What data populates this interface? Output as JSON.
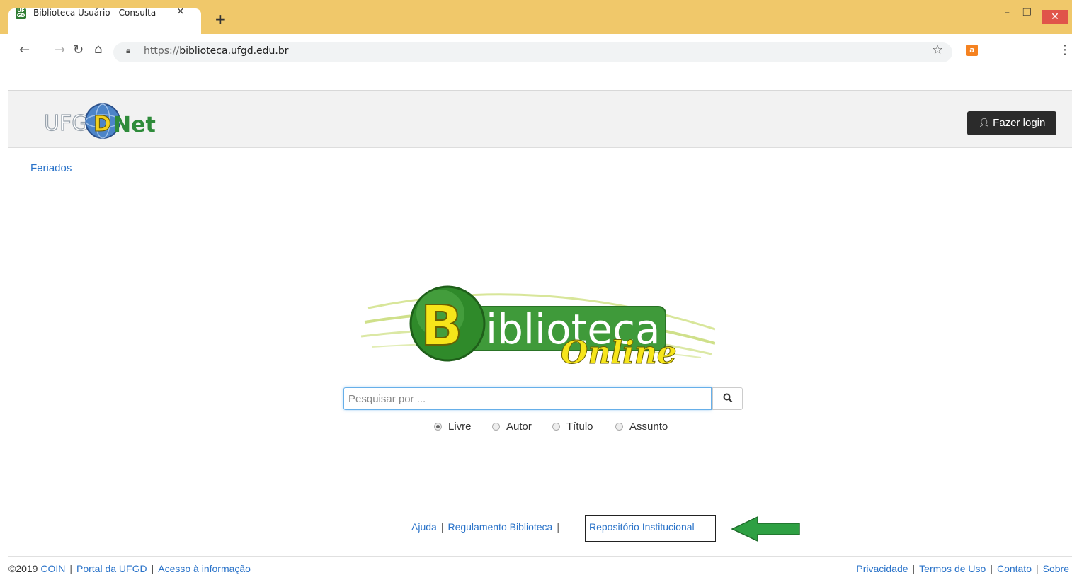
{
  "browser": {
    "tab_title": "Biblioteca Usuário - Consulta",
    "favicon_text": "UF GD",
    "close_tab": "×",
    "new_tab": "+",
    "url_scheme": "https://",
    "url_host": "biblioteca.ufgd.edu.br",
    "extension_label": "a",
    "icons": [
      "back-icon",
      "forward-icon",
      "reload-icon",
      "home-icon",
      "lock-icon",
      "star-icon",
      "extension-icon",
      "menu-icon"
    ]
  },
  "header": {
    "logo_text_left": "UFG",
    "logo_text_right": "Net",
    "logo_letter": "D",
    "login_label": "Fazer login"
  },
  "nav": {
    "feriados": "Feriados"
  },
  "main": {
    "logo_big_letter": "B",
    "logo_word": "iblioteca",
    "logo_online": "Online",
    "search_placeholder": "Pesquisar por ...",
    "search_value": "",
    "filters": [
      {
        "label": "Livre",
        "checked": true
      },
      {
        "label": "Autor",
        "checked": false
      },
      {
        "label": "Título",
        "checked": false
      },
      {
        "label": "Assunto",
        "checked": false
      }
    ]
  },
  "links": {
    "ajuda": "Ajuda",
    "regulamento": "Regulamento Biblioteca",
    "repositorio": "Repositório Institucional",
    "separator": "|"
  },
  "footer": {
    "copyright": "©2019",
    "coin": "COIN",
    "portal": "Portal da UFGD",
    "acesso": "Acesso à informação",
    "privacidade": "Privacidade",
    "termos": "Termos de Uso",
    "contato": "Contato",
    "sobre": "Sobre"
  },
  "colors": {
    "tabbar": "#f0c86a",
    "link": "#2a73c9",
    "login_bg": "#2b2b2b",
    "arrow": "#2ea043"
  }
}
